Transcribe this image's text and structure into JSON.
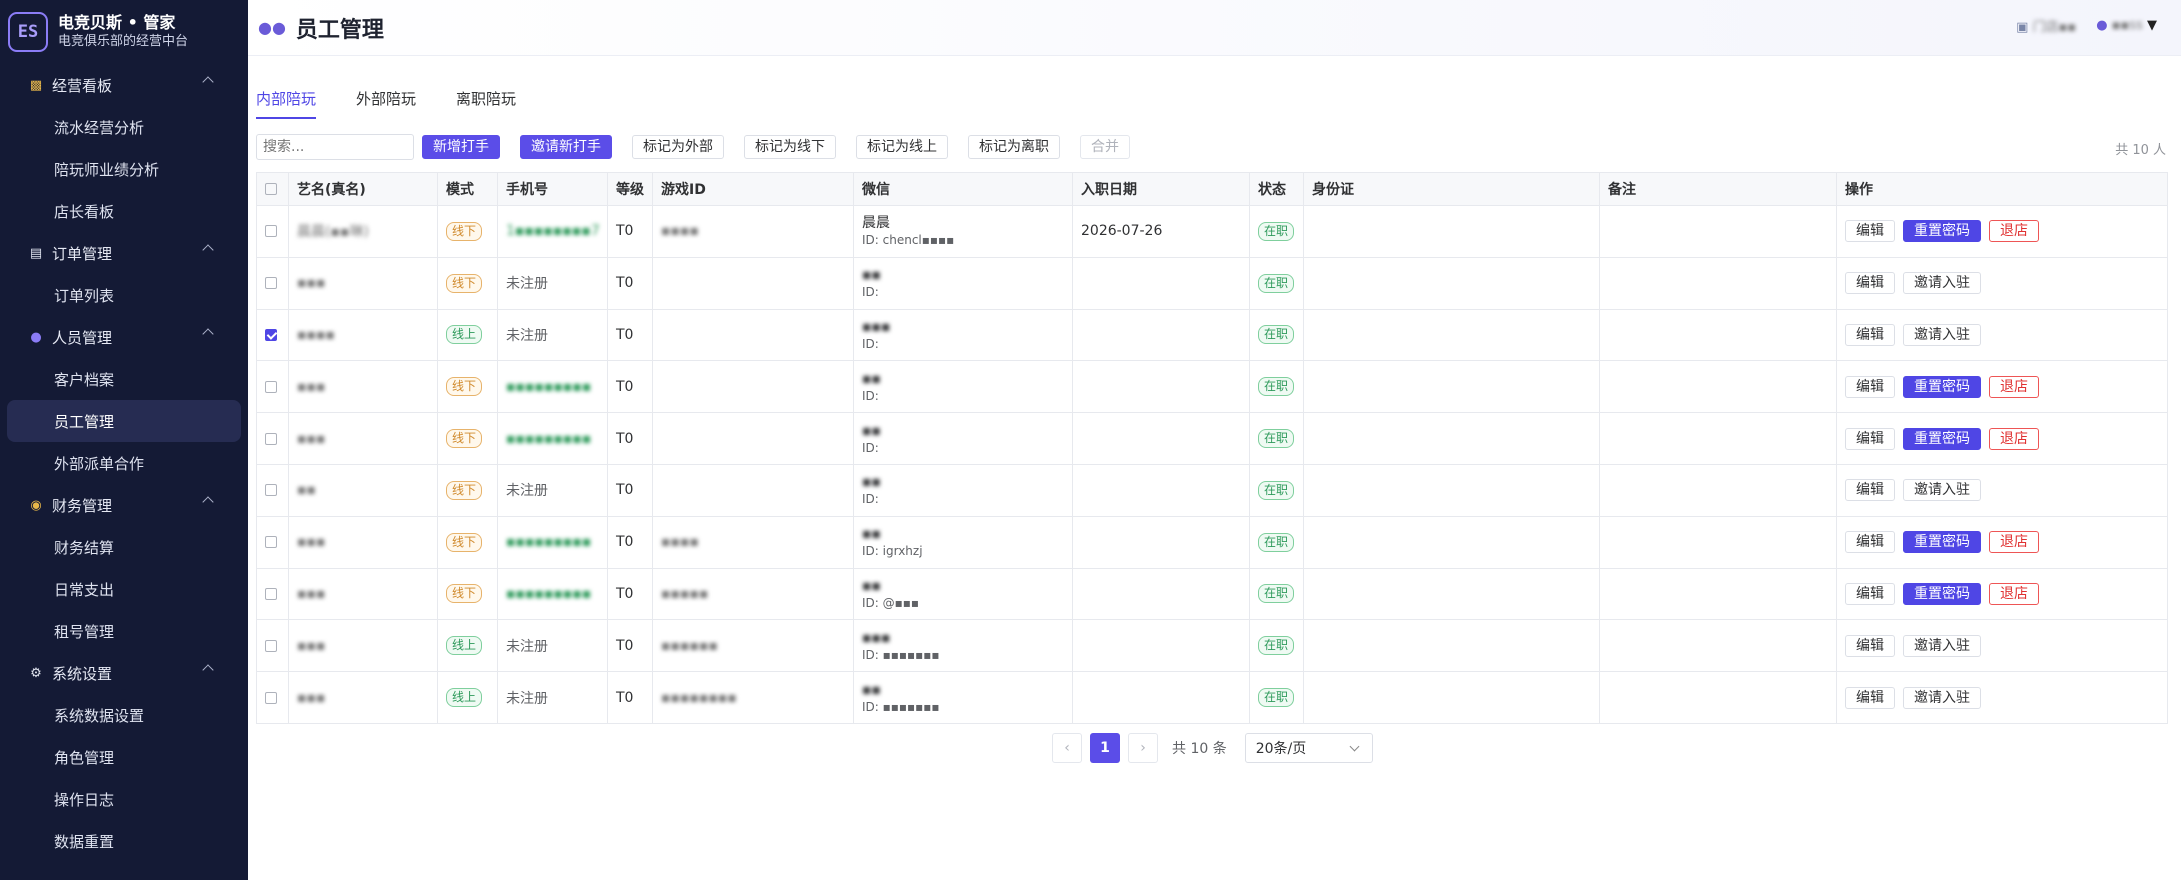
{
  "brand": {
    "logo": "ES",
    "title": "电竞贝斯 • 管家",
    "subtitle": "电竞俱乐部的经营中台"
  },
  "sidebar": {
    "groups": [
      {
        "label": "经营看板",
        "icon": "chart-icon",
        "items": [
          "流水经营分析",
          "陪玩师业绩分析",
          "店长看板"
        ]
      },
      {
        "label": "订单管理",
        "icon": "clipboard-icon",
        "items": [
          "订单列表"
        ]
      },
      {
        "label": "人员管理",
        "icon": "people-icon",
        "items": [
          "客户档案",
          "员工管理",
          "外部派单合作"
        ]
      },
      {
        "label": "财务管理",
        "icon": "money-bag-icon",
        "items": [
          "财务结算",
          "日常支出",
          "租号管理"
        ]
      },
      {
        "label": "系统设置",
        "icon": "gear-icon",
        "items": [
          "系统数据设置",
          "角色管理",
          "操作日志",
          "数据重置"
        ]
      }
    ],
    "active_item": "员工管理"
  },
  "header": {
    "title": "员工管理",
    "store": "门店▪▪",
    "user": "▪▪ss"
  },
  "tabs": [
    "内部陪玩",
    "外部陪玩",
    "离职陪玩"
  ],
  "toolbar": {
    "search_placeholder": "搜索...",
    "buttons": [
      "新增打手",
      "邀请新打手",
      "标记为外部",
      "标记为线下",
      "标记为线上",
      "标记为离职",
      "合并"
    ],
    "count": "共 10 人"
  },
  "table": {
    "columns": [
      "艺名(真名)",
      "模式",
      "手机号",
      "等级",
      "游戏ID",
      "微信",
      "入职日期",
      "状态",
      "身份证",
      "备注",
      "操作"
    ],
    "rows": [
      {
        "checked": false,
        "name": "晨晨(▪▪琳)",
        "mode": "线下",
        "phone": "1▪▪▪▪▪▪▪▪7",
        "phone_registered": true,
        "level": "T0",
        "game_id": "▪▪▪▪",
        "wx_name": "晨晨",
        "wx_id": "ID: chencl▪▪▪▪",
        "join_date": "2026-07-26",
        "status": "在职",
        "idcard": "",
        "note": "",
        "actions": [
          "编辑",
          "重置密码",
          "退店"
        ]
      },
      {
        "checked": false,
        "name": "▪▪▪",
        "mode": "线下",
        "phone": "未注册",
        "phone_registered": false,
        "level": "T0",
        "game_id": "",
        "wx_name": "▪▪",
        "wx_id": "ID:",
        "join_date": "",
        "status": "在职",
        "idcard": "",
        "note": "",
        "actions": [
          "编辑",
          "邀请入驻"
        ]
      },
      {
        "checked": true,
        "name": "▪▪▪▪",
        "mode": "线上",
        "phone": "未注册",
        "phone_registered": false,
        "level": "T0",
        "game_id": "",
        "wx_name": "▪▪▪",
        "wx_id": "ID:",
        "join_date": "",
        "status": "在职",
        "idcard": "",
        "note": "",
        "actions": [
          "编辑",
          "邀请入驻"
        ]
      },
      {
        "checked": false,
        "name": "▪▪▪",
        "mode": "线下",
        "phone": "▪▪▪▪▪▪▪▪▪",
        "phone_registered": true,
        "level": "T0",
        "game_id": "",
        "wx_name": "▪▪",
        "wx_id": "ID:",
        "join_date": "",
        "status": "在职",
        "idcard": "",
        "note": "",
        "actions": [
          "编辑",
          "重置密码",
          "退店"
        ]
      },
      {
        "checked": false,
        "name": "▪▪▪",
        "mode": "线下",
        "phone": "▪▪▪▪▪▪▪▪▪",
        "phone_registered": true,
        "level": "T0",
        "game_id": "",
        "wx_name": "▪▪",
        "wx_id": "ID:",
        "join_date": "",
        "status": "在职",
        "idcard": "",
        "note": "",
        "actions": [
          "编辑",
          "重置密码",
          "退店"
        ]
      },
      {
        "checked": false,
        "name": "▪▪",
        "mode": "线下",
        "phone": "未注册",
        "phone_registered": false,
        "level": "T0",
        "game_id": "",
        "wx_name": "▪▪",
        "wx_id": "ID:",
        "join_date": "",
        "status": "在职",
        "idcard": "",
        "note": "",
        "actions": [
          "编辑",
          "邀请入驻"
        ]
      },
      {
        "checked": false,
        "name": "▪▪▪",
        "mode": "线下",
        "phone": "▪▪▪▪▪▪▪▪▪",
        "phone_registered": true,
        "level": "T0",
        "game_id": "▪▪▪▪",
        "wx_name": "▪▪",
        "wx_id": "ID: igrxhzj",
        "join_date": "",
        "status": "在职",
        "idcard": "",
        "note": "",
        "actions": [
          "编辑",
          "重置密码",
          "退店"
        ]
      },
      {
        "checked": false,
        "name": "▪▪▪",
        "mode": "线下",
        "phone": "▪▪▪▪▪▪▪▪▪",
        "phone_registered": true,
        "level": "T0",
        "game_id": "▪▪▪▪▪",
        "wx_name": "▪▪",
        "wx_id": "ID: @▪▪▪",
        "join_date": "",
        "status": "在职",
        "idcard": "",
        "note": "",
        "actions": [
          "编辑",
          "重置密码",
          "退店"
        ]
      },
      {
        "checked": false,
        "name": "▪▪▪",
        "mode": "线上",
        "phone": "未注册",
        "phone_registered": false,
        "level": "T0",
        "game_id": "▪▪▪▪▪▪",
        "wx_name": "▪▪▪",
        "wx_id": "ID: ▪▪▪▪▪▪▪",
        "join_date": "",
        "status": "在职",
        "idcard": "",
        "note": "",
        "actions": [
          "编辑",
          "邀请入驻"
        ]
      },
      {
        "checked": false,
        "name": "▪▪▪",
        "mode": "线上",
        "phone": "未注册",
        "phone_registered": false,
        "level": "T0",
        "game_id": "▪▪▪▪▪▪▪▪",
        "wx_name": "▪▪",
        "wx_id": "ID: ▪▪▪▪▪▪▪",
        "join_date": "",
        "status": "在职",
        "idcard": "",
        "note": "",
        "actions": [
          "编辑",
          "邀请入驻"
        ]
      }
    ]
  },
  "pagination": {
    "current": "1",
    "total": "共 10 条",
    "page_size": "20条/页"
  },
  "colors": {
    "sidebar_bg": "#141a35",
    "accent": "#5b4de8",
    "danger": "#e03131",
    "success": "#2e9a5b",
    "offline": "#d08a2d"
  }
}
